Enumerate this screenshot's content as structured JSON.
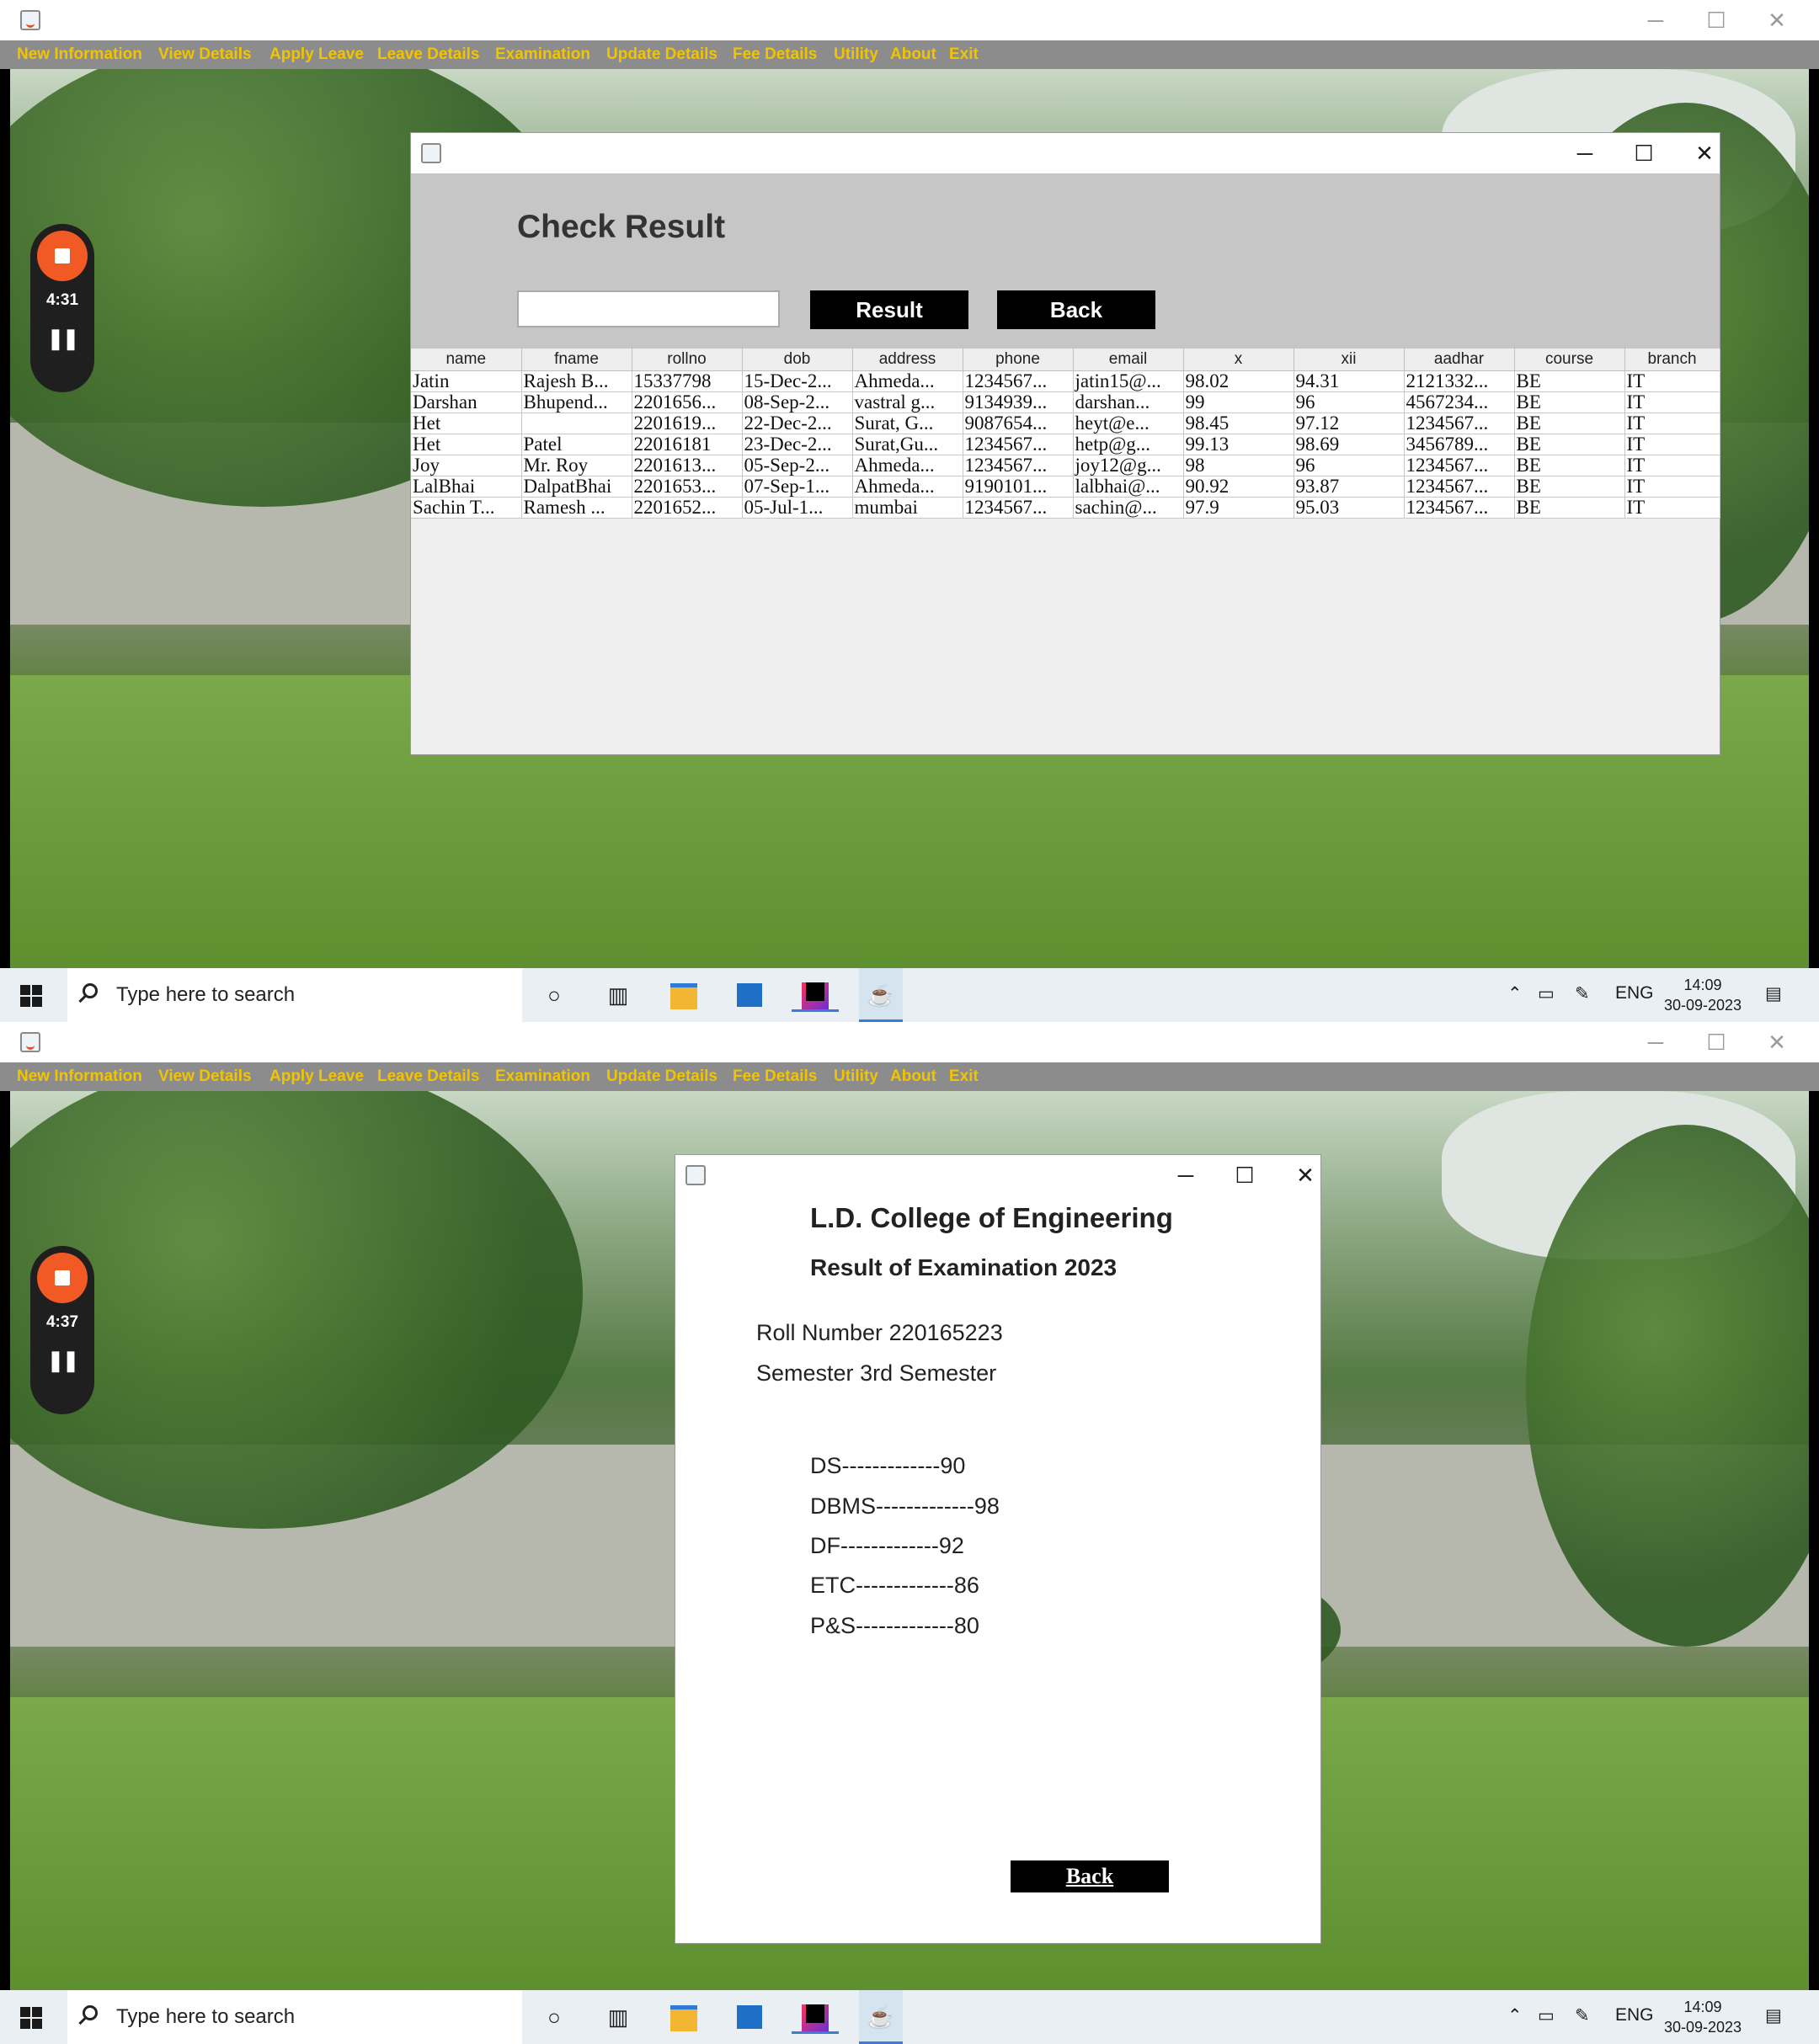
{
  "menu": [
    "New Information",
    "View Details",
    "Apply Leave",
    "Leave Details",
    "Examination",
    "Update Details",
    "Fee Details",
    "Utility",
    "About",
    "Exit"
  ],
  "window_controls": {
    "minimize": "─",
    "maximize": "☐",
    "close": "✕"
  },
  "recorder": {
    "top_time": "4:31",
    "bottom_time": "4:37",
    "pause": "❚❚"
  },
  "taskbar": {
    "search_placeholder": "Type here to search",
    "language": "ENG",
    "time": "14:09",
    "date": "30-09-2023",
    "icons": [
      "start-icon",
      "cortana-icon",
      "task-view-icon",
      "file-explorer-icon",
      "store-icon",
      "intellij-icon",
      "java-app-icon"
    ],
    "tray_icons": [
      "chevron-up-icon",
      "network-icon",
      "pen-icon",
      "notification-icon"
    ]
  },
  "check_result": {
    "heading": "Check Result",
    "search_value": "",
    "result_button": "Result",
    "back_button": "Back",
    "columns": [
      "name",
      "fname",
      "rollno",
      "dob",
      "address",
      "phone",
      "email",
      "x",
      "xii",
      "aadhar",
      "course",
      "branch"
    ],
    "rows": [
      [
        "Jatin",
        "Rajesh B...",
        "15337798",
        "15-Dec-2...",
        "Ahmeda...",
        "1234567...",
        "jatin15@...",
        "98.02",
        "94.31",
        "2121332...",
        "BE",
        "IT"
      ],
      [
        "Darshan",
        "Bhupend...",
        "2201656...",
        "08-Sep-2...",
        "vastral g...",
        "9134939...",
        "darshan...",
        "99",
        "96",
        "4567234...",
        "BE",
        "IT"
      ],
      [
        "Het",
        "",
        "2201619...",
        "22-Dec-2...",
        "Surat, G...",
        "9087654...",
        "heyt@e...",
        "98.45",
        "97.12",
        "1234567...",
        "BE",
        "IT"
      ],
      [
        "Het",
        "Patel",
        "22016181",
        "23-Dec-2...",
        "Surat,Gu...",
        "1234567...",
        "hetp@g...",
        "99.13",
        "98.69",
        "3456789...",
        "BE",
        "IT"
      ],
      [
        "Joy",
        "Mr. Roy",
        "2201613...",
        "05-Sep-2...",
        "Ahmeda...",
        "1234567...",
        "joy12@g...",
        "98",
        "96",
        "1234567...",
        "BE",
        "IT"
      ],
      [
        "LalBhai",
        "DalpatBhai",
        "2201653...",
        "07-Sep-1...",
        "Ahmeda...",
        "9190101...",
        "lalbhai@...",
        "90.92",
        "93.87",
        "1234567...",
        "BE",
        "IT"
      ],
      [
        "Sachin T...",
        "Ramesh ...",
        "2201652...",
        "05-Jul-1...",
        "mumbai",
        "1234567...",
        "sachin@...",
        "97.9",
        "95.03",
        "1234567...",
        "BE",
        "IT"
      ]
    ]
  },
  "result": {
    "college": "L.D. College of Engineering",
    "exam_title": "Result of Examination 2023",
    "roll_label": "Roll Number",
    "roll_value": "220165223",
    "semester_label": "Semester",
    "semester_value": "3rd Semester",
    "subjects": [
      "DS-------------90",
      "DBMS-------------98",
      "DF-------------92",
      "ETC-------------86",
      "P&S-------------80"
    ],
    "back_button": "Back"
  }
}
